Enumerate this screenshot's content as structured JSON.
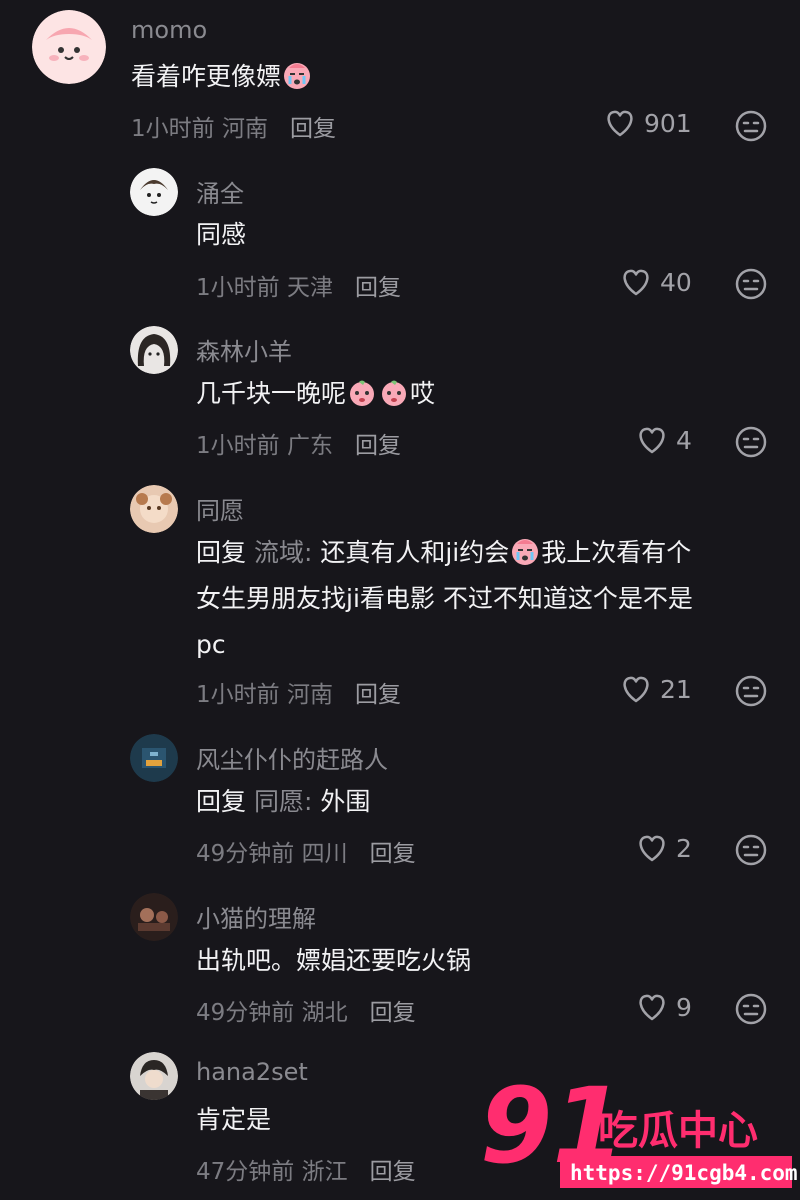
{
  "comments": [
    {
      "user": "momo",
      "text": "看着咋更像嫖",
      "time": "1小时前",
      "location": "河南",
      "reply": "回复",
      "likes": "901"
    },
    {
      "user": "涌全",
      "text": "同感",
      "time": "1小时前",
      "location": "天津",
      "reply": "回复",
      "likes": "40"
    },
    {
      "user": "森林小羊",
      "text_a": "几千块一晚呢",
      "text_b": "哎",
      "time": "1小时前",
      "location": "广东",
      "reply": "回复",
      "likes": "4"
    },
    {
      "user": "同愿",
      "reply_prefix": "回复",
      "mention": "流域:",
      "line1_a": "还真有人和ji约会",
      "line1_b": "我上次看有个",
      "line2": "女生男朋友找ji看电影 不过不知道这个是不是",
      "line3": "pc",
      "time": "1小时前",
      "location": "河南",
      "reply": "回复",
      "likes": "21"
    },
    {
      "user": "风尘仆仆的赶路人",
      "reply_prefix": "回复",
      "mention": "同愿:",
      "text": "外围",
      "time": "49分钟前",
      "location": "四川",
      "reply": "回复",
      "likes": "2"
    },
    {
      "user": "小猫的理解",
      "text": "出轨吧。嫖娼还要吃火锅",
      "time": "49分钟前",
      "location": "湖北",
      "reply": "回复",
      "likes": "9"
    },
    {
      "user": "hana2set",
      "text": "肯定是",
      "time": "47分钟前",
      "location": "浙江",
      "reply": "回复"
    }
  ],
  "watermark": {
    "brand": "吃瓜中心",
    "number": "91",
    "url": "https://91cgb4.com"
  },
  "colors": {
    "background": "#17161b",
    "watermark": "#ff2d6f"
  }
}
